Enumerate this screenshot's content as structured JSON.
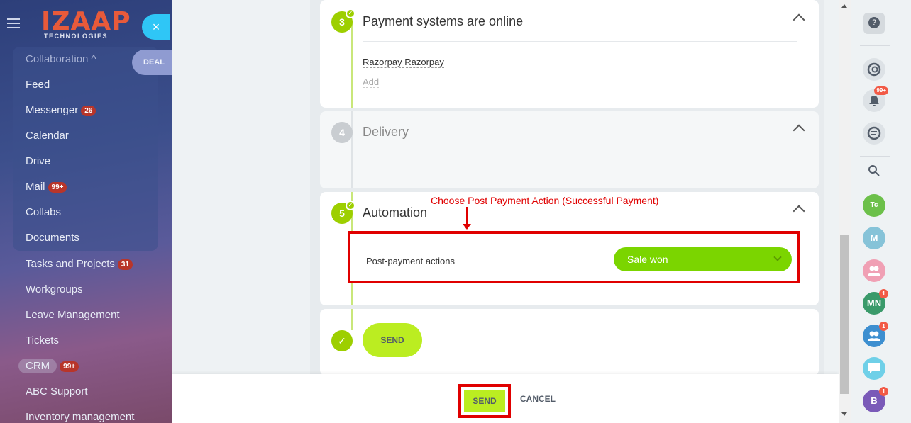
{
  "sidebar": {
    "logo": "IZAAP",
    "logo_sub": "TECHNOLOGIES",
    "close_icon": "×",
    "deal_tab": "DEAL",
    "section_head": "Collaboration ^",
    "items": [
      {
        "label": "Feed",
        "badge": ""
      },
      {
        "label": "Messenger",
        "badge": "26"
      },
      {
        "label": "Calendar",
        "badge": ""
      },
      {
        "label": "Drive",
        "badge": ""
      },
      {
        "label": "Mail",
        "badge": "99+"
      },
      {
        "label": "Collabs",
        "badge": ""
      },
      {
        "label": "Documents",
        "badge": ""
      },
      {
        "label": "Tasks and Projects",
        "badge": "31"
      },
      {
        "label": "Workgroups",
        "badge": ""
      },
      {
        "label": "Leave Management",
        "badge": ""
      },
      {
        "label": "Tickets",
        "badge": ""
      },
      {
        "label": "CRM",
        "badge": "99+"
      },
      {
        "label": "ABC Support",
        "badge": ""
      },
      {
        "label": "Inventory management",
        "badge": ""
      }
    ]
  },
  "steps": {
    "payment": {
      "num": "3",
      "title": "Payment systems are online",
      "link": "Razorpay Razorpay",
      "add": "Add"
    },
    "delivery": {
      "num": "4",
      "title": "Delivery"
    },
    "automation": {
      "num": "5",
      "title": "Automation",
      "label": "Post-payment actions",
      "select_value": "Sale won"
    },
    "send": {
      "label": "SEND"
    }
  },
  "annotation": "Choose Post Payment Action (Successful Payment)",
  "footer": {
    "send": "SEND",
    "cancel": "CANCEL"
  },
  "right_panel": {
    "help": "?",
    "notifications_badge": "99+",
    "avatars": [
      {
        "text": "Tc",
        "color": "#6cc04a"
      },
      {
        "text": "M",
        "color": "#86c3d8"
      },
      {
        "text": "",
        "color": "#f0a0b4"
      },
      {
        "text": "MN",
        "color": "#3a9a6a",
        "badge": "1"
      },
      {
        "text": "",
        "color": "#3d8fd0",
        "badge": "1"
      },
      {
        "text": "",
        "color": "#6fd0e8"
      },
      {
        "text": "B",
        "color": "#7a5ab8",
        "badge": "1"
      }
    ]
  },
  "colors": {
    "accent_green": "#9dcf00",
    "button_lime": "#bbed21",
    "select_green": "#7bd500",
    "annotation_red": "#e00000",
    "close_blue": "#2fc6f6"
  }
}
